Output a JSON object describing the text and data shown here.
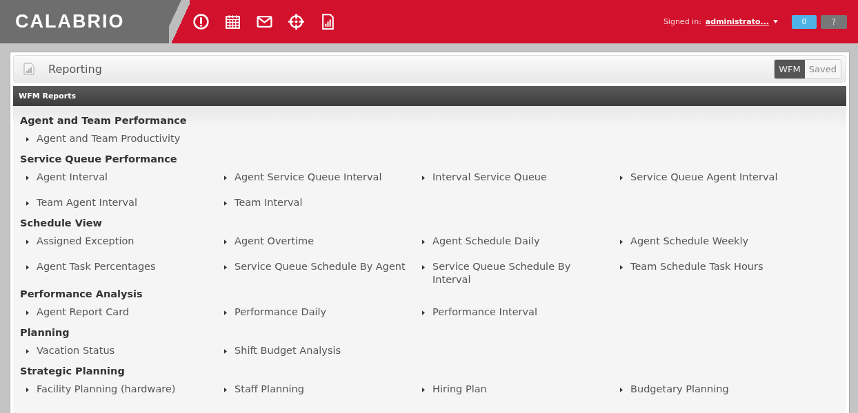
{
  "header": {
    "logo": "CALABRIO",
    "signed_in_label": "Signed in:",
    "user": "administrato...",
    "notifications": "0",
    "help": "?"
  },
  "page": {
    "title": "Reporting",
    "toggles": [
      {
        "label": "WFM",
        "selected": true
      },
      {
        "label": "Saved",
        "selected": false
      }
    ]
  },
  "panel": {
    "title": "WFM Reports",
    "sections": [
      {
        "title": "Agent and Team Performance",
        "items": [
          "Agent and Team Productivity"
        ]
      },
      {
        "title": "Service Queue Performance",
        "items": [
          "Agent Interval",
          "Agent Service Queue Interval",
          "Interval Service Queue",
          "Service Queue Agent Interval",
          "Team Agent Interval",
          "Team Interval"
        ]
      },
      {
        "title": "Schedule View",
        "items": [
          "Assigned Exception",
          "Agent Overtime",
          "Agent Schedule Daily",
          "Agent Schedule Weekly",
          "Agent Task Percentages",
          "Service Queue Schedule By Agent",
          "Service Queue Schedule By Interval",
          "Team Schedule Task Hours"
        ]
      },
      {
        "title": "Performance Analysis",
        "items": [
          "Agent Report Card",
          "Performance Daily",
          "Performance Interval"
        ]
      },
      {
        "title": "Planning",
        "items": [
          "Vacation Status",
          "Shift Budget Analysis"
        ]
      },
      {
        "title": "Strategic Planning",
        "items": [
          "Facility Planning (hardware)",
          "Staff Planning",
          "Hiring Plan",
          "Budgetary Planning"
        ]
      }
    ]
  }
}
